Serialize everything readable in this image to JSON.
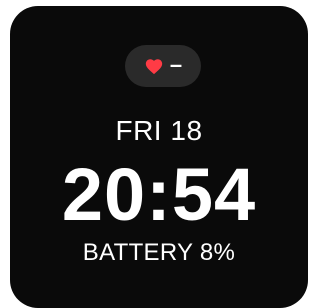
{
  "heart_rate": {
    "icon": "heart-icon",
    "value": "–",
    "icon_color": "#ff3b45"
  },
  "date": "FRI 18",
  "time": "20:54",
  "battery": "BATTERY 8%",
  "colors": {
    "background": "#0a0a0a",
    "pill": "#2a2a2a",
    "text": "#ffffff"
  }
}
